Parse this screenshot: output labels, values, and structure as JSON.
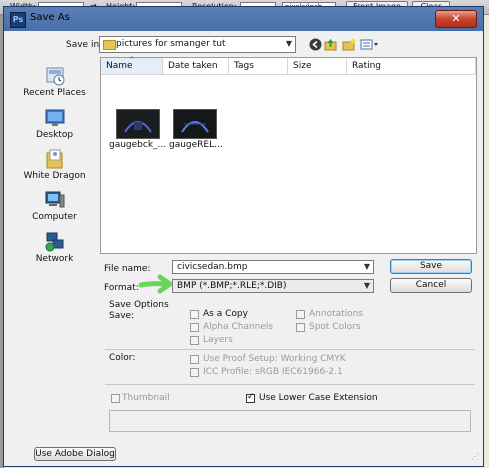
{
  "ps_bar": {
    "width_label": "Width:",
    "height_label": "Height:",
    "resolution_label": "Resolution:",
    "units_value": "pixels/inch",
    "front_image_label": "Front Image",
    "clear_label": "Clear"
  },
  "dialog": {
    "title": "Save As",
    "app_badge": "Ps",
    "close_glyph": "✕",
    "save_in_label": "Save in:",
    "save_in_value": "pictures for smanger tut",
    "places": [
      {
        "label": "Recent Places"
      },
      {
        "label": "Desktop"
      },
      {
        "label": "White Dragon"
      },
      {
        "label": "Computer"
      },
      {
        "label": "Network"
      }
    ],
    "columns": [
      "Name",
      "Date taken",
      "Tags",
      "Size",
      "Rating"
    ],
    "files": [
      {
        "name": "gaugebck_..."
      },
      {
        "name": "gaugeREL..."
      }
    ],
    "file_name_label": "File name:",
    "file_name_value": "civicsedan.bmp",
    "format_label": "Format:",
    "format_value": "BMP (*.BMP;*.RLE;*.DIB)",
    "save_button": "Save",
    "cancel_button": "Cancel",
    "save_options_label": "Save Options",
    "save_label": "Save:",
    "as_a_copy": "As a Copy",
    "annotations": "Annotations",
    "alpha_channels": "Alpha Channels",
    "spot_colors": "Spot Colors",
    "layers": "Layers",
    "color_label": "Color:",
    "use_proof_setup": "Use Proof Setup:  Working CMYK",
    "icc_profile": "ICC Profile:  sRGB IEC61966-2.1",
    "thumbnail": "Thumbnail",
    "lower_case_ext": "Use Lower Case Extension",
    "use_adobe_dialog": "Use Adobe Dialog",
    "accent_arrow_color": "#6dd35c"
  }
}
